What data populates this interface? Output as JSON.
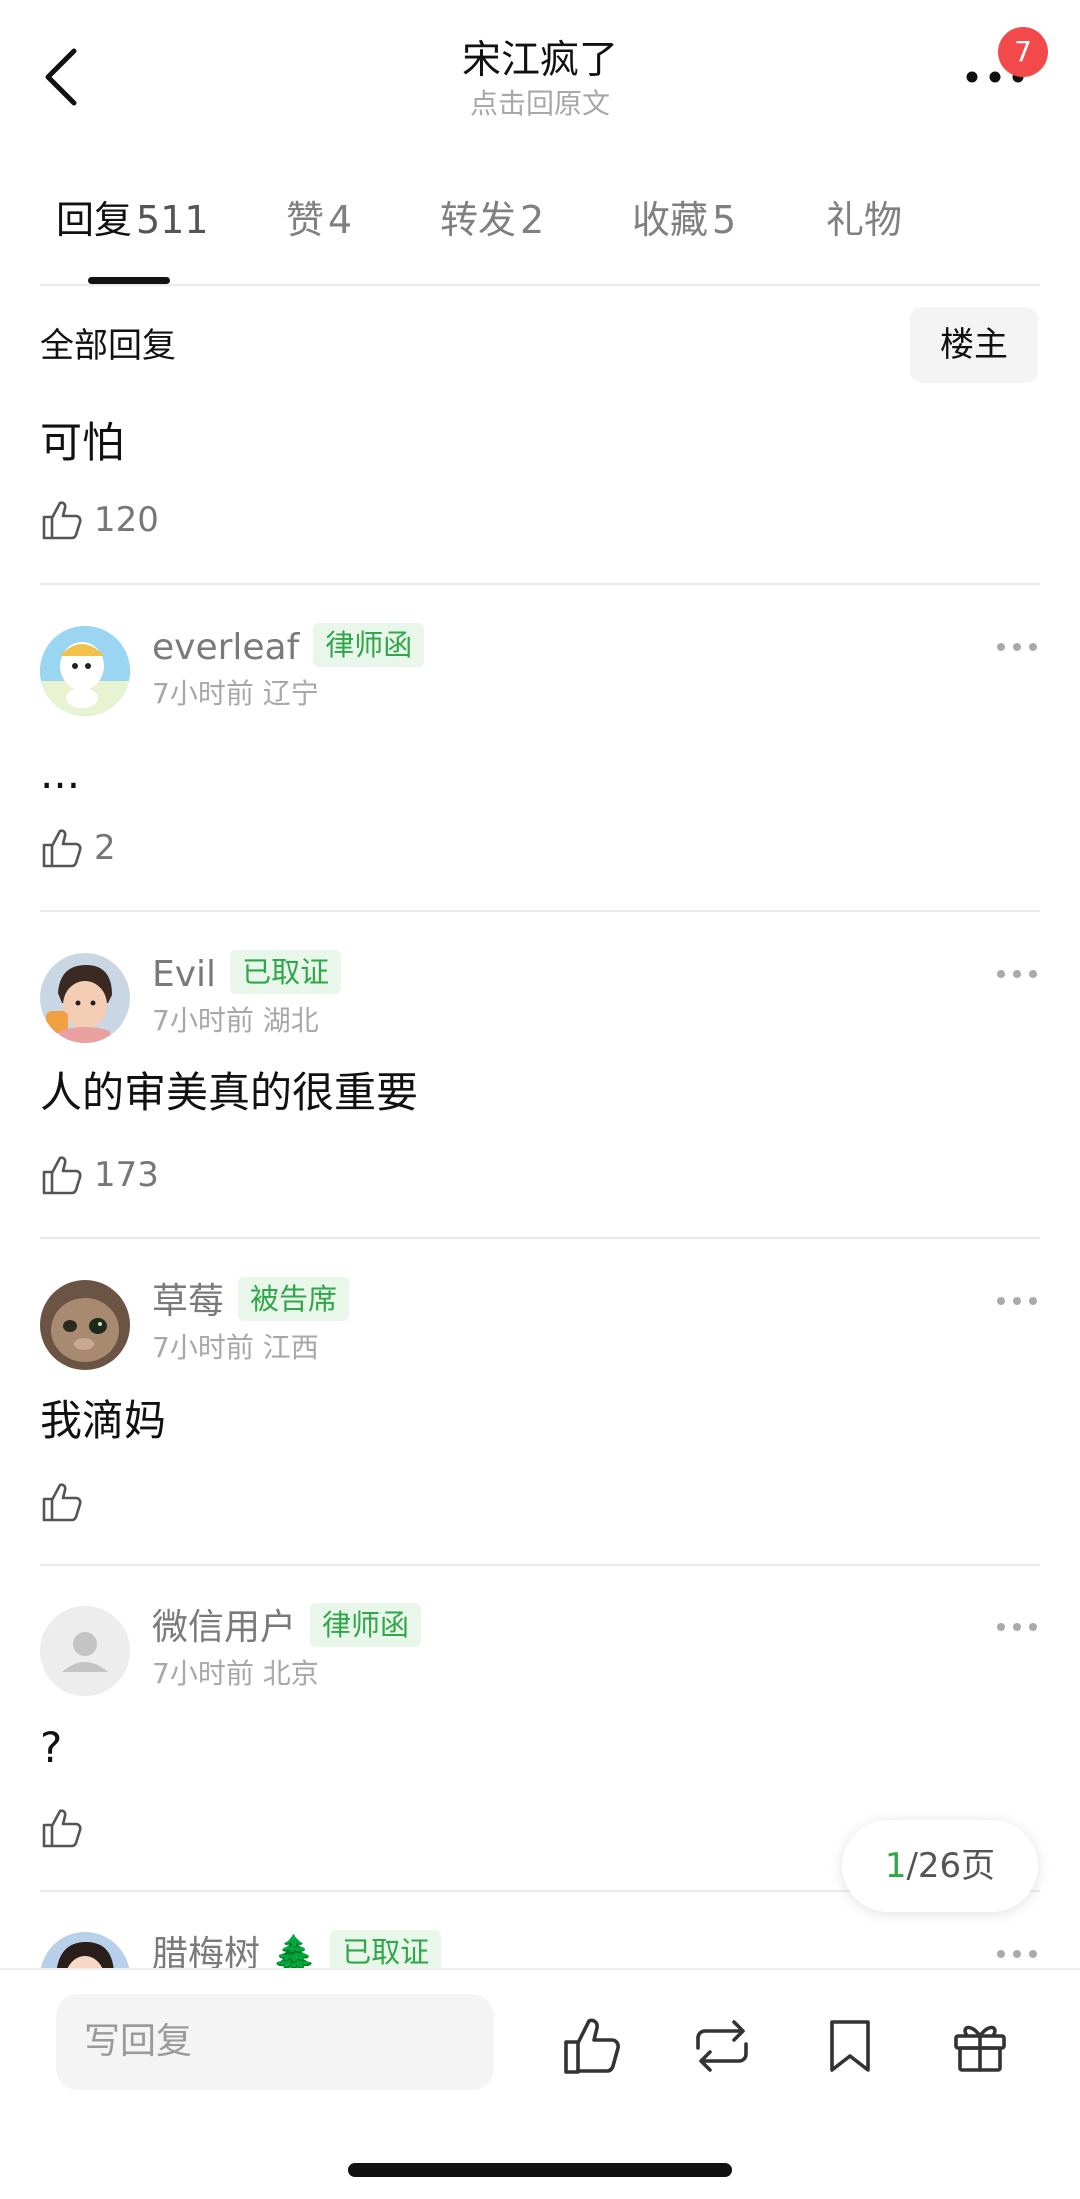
{
  "header": {
    "title": "宋江疯了",
    "subtitle": "点击回原文",
    "badge": "7"
  },
  "tabs": [
    {
      "label": "回复",
      "count": "511",
      "active": true
    },
    {
      "label": "赞",
      "count": "4"
    },
    {
      "label": "转发",
      "count": "2"
    },
    {
      "label": "收藏",
      "count": "5"
    },
    {
      "label": "礼物",
      "count": ""
    }
  ],
  "section": {
    "title": "全部回复",
    "owner_button": "楼主"
  },
  "first_comment": {
    "text": "可怕",
    "likes": "120"
  },
  "comments": [
    {
      "name": "everleaf",
      "tag": "律师函",
      "time": "7小时前",
      "region": "辽宁",
      "text": "...",
      "likes": "2"
    },
    {
      "name": "Evil",
      "tag": "已取证",
      "time": "7小时前",
      "region": "湖北",
      "text": "人的审美真的很重要",
      "likes": "173"
    },
    {
      "name": "草莓",
      "tag": "被告席",
      "time": "7小时前",
      "region": "江西",
      "text": "我滴妈",
      "likes": ""
    },
    {
      "name": "微信用户",
      "tag": "律师函",
      "time": "7小时前",
      "region": "北京",
      "text": "?",
      "likes": ""
    },
    {
      "name": "腊梅树 🌲",
      "tag": "已取证"
    }
  ],
  "pager": {
    "current": "1",
    "total": "/26页"
  },
  "bottom_bar": {
    "reply_placeholder": "写回复",
    "icons": [
      "like-icon",
      "repost-icon",
      "bookmark-icon",
      "gift-icon"
    ]
  },
  "colors": {
    "accent_green": "#2fa74a",
    "badge_red": "#f24a4a"
  }
}
